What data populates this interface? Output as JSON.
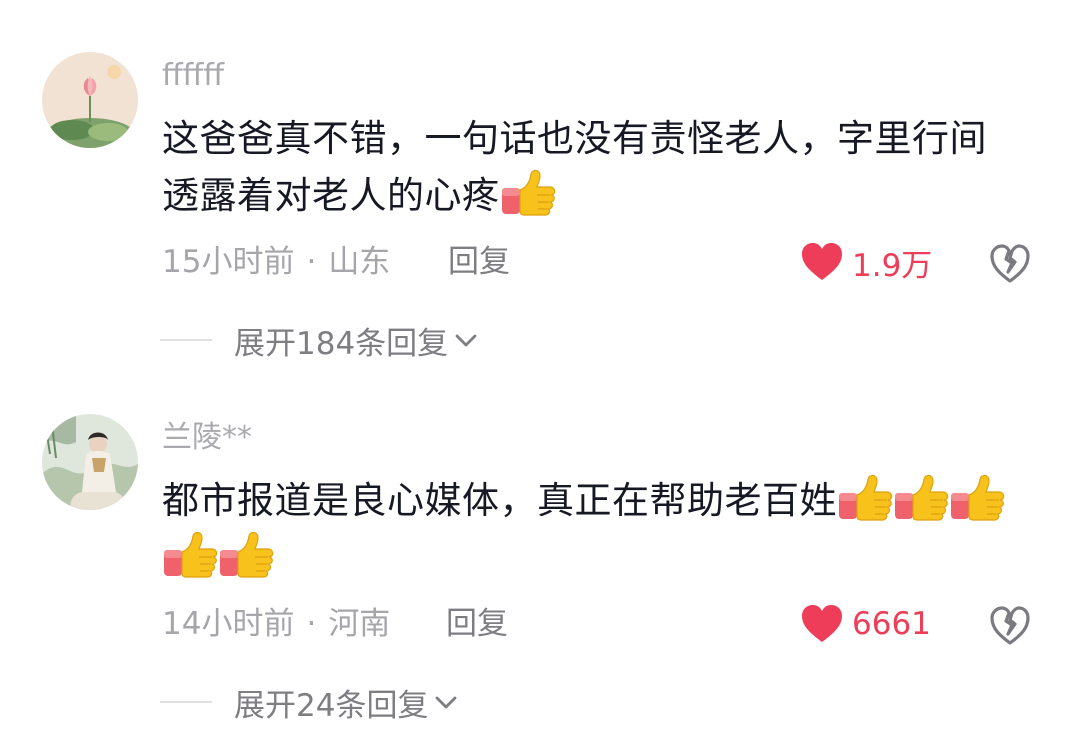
{
  "comments": [
    {
      "username": "ffffff",
      "text_line1": "这爸爸真不错，一句话也没有责怪老人，字里行间",
      "text_line2": "透露着对老人的心疼",
      "thumbs": [
        "thumbs-up-emoji"
      ],
      "time": "15小时前",
      "separator": "·",
      "location": "山东",
      "reply_label": "回复",
      "likes": "1.9万",
      "expand_label": "展开184条回复"
    },
    {
      "username": "兰陵**",
      "text_line1": "都市报道是良心媒体，真正在帮助老百姓",
      "thumbs_line1": [
        "thumbs-up-emoji",
        "thumbs-up-emoji",
        "thumbs-up-emoji"
      ],
      "thumbs_line2": [
        "thumbs-up-emoji",
        "thumbs-up-emoji"
      ],
      "time": "14小时前",
      "separator": "·",
      "location": "河南",
      "reply_label": "回复",
      "likes": "6661",
      "expand_label": "展开24条回复"
    }
  ],
  "icons": {
    "like": "heart-icon",
    "dislike": "broken-heart-icon",
    "expand": "chevron-down-icon",
    "emoji": "thumbs-up-emoji"
  },
  "colors": {
    "like_red": "#ee3d58",
    "meta_gray": "#a5a5aa",
    "text_dark": "#161823",
    "thumb_yellow": "#f7c21b",
    "sleeve_red": "#f0626b"
  }
}
